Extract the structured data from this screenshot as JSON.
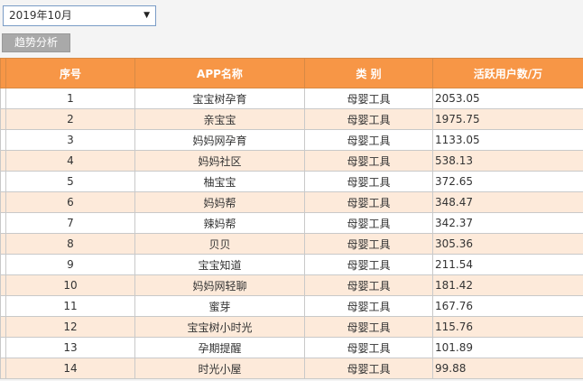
{
  "filter": {
    "selected_month": "2019年10月",
    "trend_button_label": "趋势分析"
  },
  "table": {
    "headers": [
      "序号",
      "APP名称",
      "类 别",
      "活跃用户数/万"
    ],
    "rows": [
      {
        "rank": "1",
        "app": "宝宝树孕育",
        "category": "母婴工具",
        "active_users": "2053.05"
      },
      {
        "rank": "2",
        "app": "亲宝宝",
        "category": "母婴工具",
        "active_users": "1975.75"
      },
      {
        "rank": "3",
        "app": "妈妈网孕育",
        "category": "母婴工具",
        "active_users": "1133.05"
      },
      {
        "rank": "4",
        "app": "妈妈社区",
        "category": "母婴工具",
        "active_users": "538.13"
      },
      {
        "rank": "5",
        "app": "柚宝宝",
        "category": "母婴工具",
        "active_users": "372.65"
      },
      {
        "rank": "6",
        "app": "妈妈帮",
        "category": "母婴工具",
        "active_users": "348.47"
      },
      {
        "rank": "7",
        "app": "辣妈帮",
        "category": "母婴工具",
        "active_users": "342.37"
      },
      {
        "rank": "8",
        "app": "贝贝",
        "category": "母婴工具",
        "active_users": "305.36"
      },
      {
        "rank": "9",
        "app": "宝宝知道",
        "category": "母婴工具",
        "active_users": "211.54"
      },
      {
        "rank": "10",
        "app": "妈妈网轻聊",
        "category": "母婴工具",
        "active_users": "181.42"
      },
      {
        "rank": "11",
        "app": "蜜芽",
        "category": "母婴工具",
        "active_users": "167.76"
      },
      {
        "rank": "12",
        "app": "宝宝树小时光",
        "category": "母婴工具",
        "active_users": "115.76"
      },
      {
        "rank": "13",
        "app": "孕期提醒",
        "category": "母婴工具",
        "active_users": "101.89"
      },
      {
        "rank": "14",
        "app": "时光小屋",
        "category": "母婴工具",
        "active_users": "99.88"
      }
    ]
  },
  "colors": {
    "header_bg": "#f79646",
    "row_alt_bg": "#fdeada",
    "button_bg": "#a9a9a9"
  }
}
